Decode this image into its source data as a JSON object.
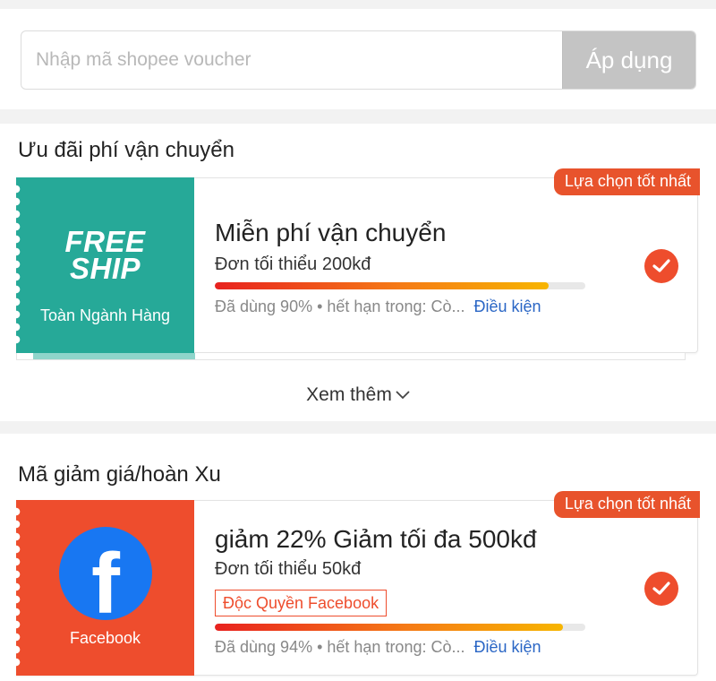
{
  "voucher_input": {
    "placeholder": "Nhập mã shopee voucher",
    "value": ""
  },
  "apply_button": "Áp dụng",
  "shipping_section": {
    "title": "Ưu đãi phí vận chuyển",
    "card": {
      "logo_line1": "FREE",
      "logo_line2": "SHIP",
      "stub_label": "Toàn Ngành Hàng",
      "badge": "Lựa chọn tốt nhất",
      "title": "Miễn phí vận chuyển",
      "min_order": "Đơn tối thiểu 200kđ",
      "used_fraction": 0.9,
      "meta": "Đã dùng 90% • hết hạn trong: Cò...",
      "condition": "Điều kiện",
      "selected": true,
      "check_icon": "check-icon"
    },
    "see_more": "Xem thêm"
  },
  "discount_section": {
    "title": "Mã giảm giá/hoàn Xu",
    "card": {
      "logo_icon": "facebook-icon",
      "logo_glyph": "f",
      "stub_label": "Facebook",
      "badge": "Lựa chọn tốt nhất",
      "title": "giảm 22% Giảm tối đa 500kđ",
      "min_order": "Đơn tối thiểu 50kđ",
      "tag": "Độc Quyền Facebook",
      "used_fraction": 0.94,
      "meta": "Đã dùng 94% • hết hạn trong: Cò...",
      "condition": "Điều kiện",
      "selected": true,
      "check_icon": "check-icon"
    }
  },
  "colors": {
    "brand": "#ee4d2d",
    "freeship": "#26a998",
    "facebook": "#1877f2",
    "link": "#2a66c5"
  }
}
